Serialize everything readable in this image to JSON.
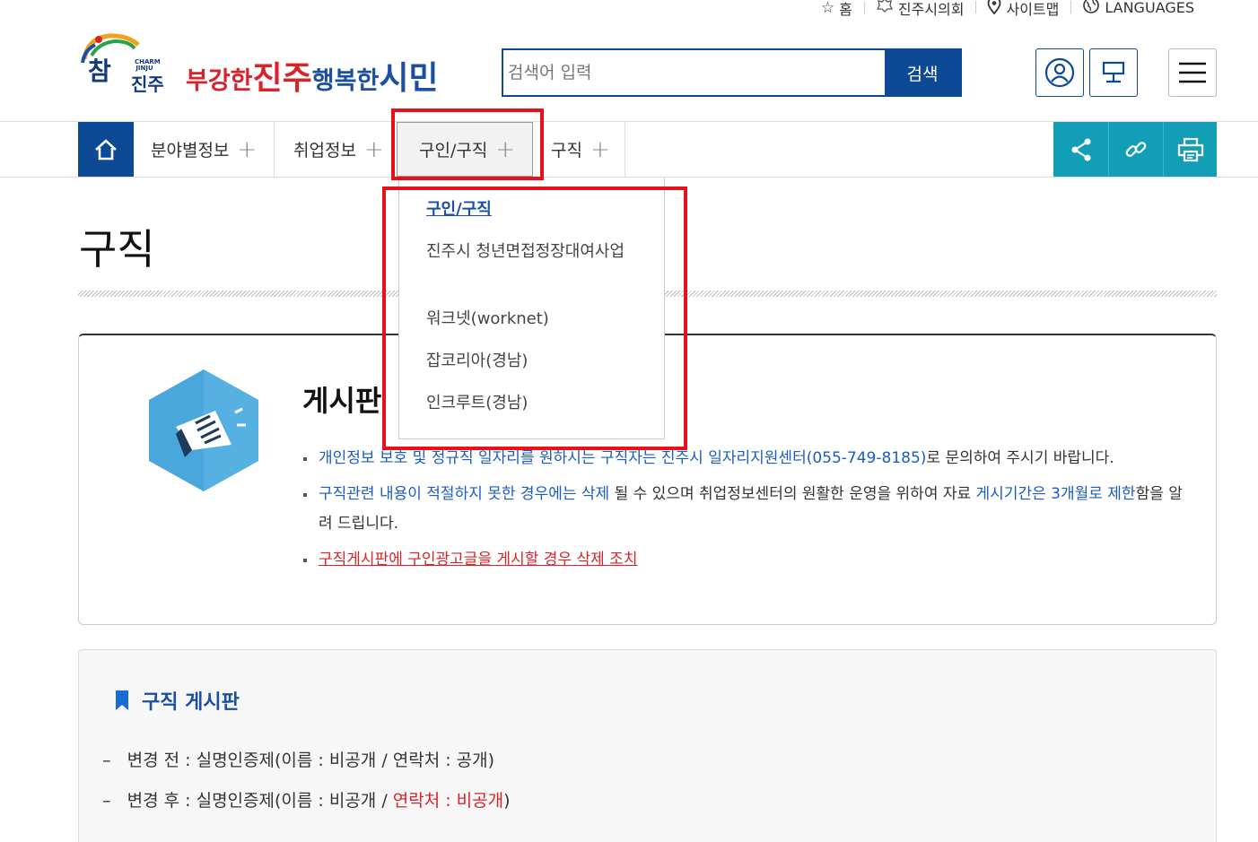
{
  "utility": {
    "home": "홈",
    "council": "진주시의회",
    "sitemap": "사이트맵",
    "languages": "LANGUAGES"
  },
  "header": {
    "logo_main": "참",
    "logo_sub": "진주",
    "logo_en": "CHARM JINJU",
    "slogan": [
      "부강한",
      "진주",
      "행복한",
      "시민"
    ],
    "search_placeholder": "검색어 입력",
    "search_button": "검색"
  },
  "gnb": {
    "tabs": [
      "분야별정보",
      "취업정보",
      "구인/구직",
      "구직"
    ],
    "active_tab": "구인/구직"
  },
  "dropdown": {
    "items": [
      "구인/구직",
      "진주시 청년면접정장대여사업",
      "워크넷(worknet)",
      "잡코리아(경남)",
      "인크루트(경남)"
    ]
  },
  "page": {
    "title": "구직"
  },
  "info": {
    "title": "게시판 ",
    "b1_blue": "개인정보 보호 및 정규직 일자리를 원하시는 구직자는 진주시 일자리지원센터(055-749-8185)",
    "b1_rest": "로 문의하여 주시기 바랍니다.",
    "b2_blue1": "구직관련 내용이 적절하지 못한 경우에는 삭제",
    "b2_mid": " 될 수 있으며 취업정보센터의 원활한 운영을 위하여 자료 ",
    "b2_blue2": "게시기간은 3개월로 제한",
    "b2_end": "함을 알려 드립니다.",
    "b3_red": "구직게시판에 구인광고글을 게시할 경우 삭제 조치"
  },
  "board": {
    "title": "구직 게시판",
    "before": "변경 전 : 실명인증제(이름 : 비공개 / 연락처 : 공개)",
    "after_prefix": "변경 후 : 실명인증제(이름 : 비공개 / ",
    "after_red": "연락처 : 비공개",
    "after_suffix": ")"
  },
  "colors": {
    "navy": "#0d4a96",
    "teal": "#139eb8",
    "red": "#d8232a",
    "highlight": "#e8111a"
  }
}
